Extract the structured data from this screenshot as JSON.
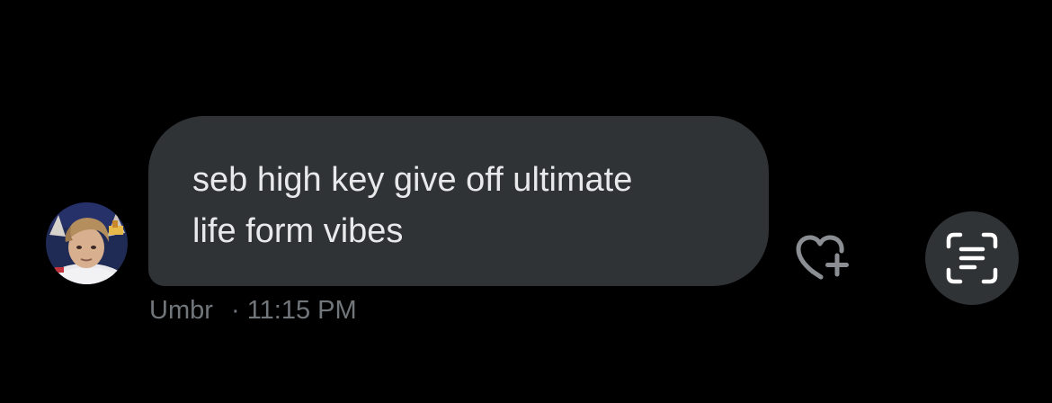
{
  "message": {
    "lines": [
      "seb high key give off ultimate",
      "life form vibes"
    ],
    "sender": "Umbr",
    "separator": "·",
    "time": "11:15 PM"
  },
  "icons": {
    "react": "heart-plus-icon",
    "translate": "scan-text-icon"
  },
  "colors": {
    "background": "#000000",
    "bubble": "#2f3336",
    "message_text": "#e7e9ea",
    "meta_text": "#71767b",
    "icon": "#8b8f94"
  }
}
